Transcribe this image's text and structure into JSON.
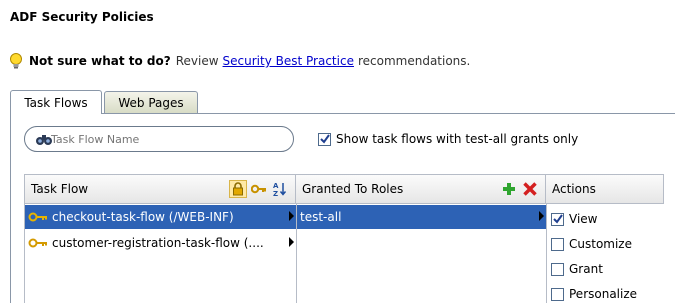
{
  "page": {
    "title": "ADF Security Policies"
  },
  "hint": {
    "bold": "Not sure what to do?",
    "review": "Review",
    "link": "Security Best Practice",
    "suffix": "recommendations."
  },
  "tabs": [
    {
      "label": "Task Flows",
      "active": true
    },
    {
      "label": "Web Pages",
      "active": false
    }
  ],
  "filter": {
    "search_placeholder": "Task Flow Name",
    "show_label": "Show task flows with test-all grants only",
    "show_checked": true
  },
  "columns": {
    "task_flow": "Task Flow",
    "roles": "Granted To Roles",
    "actions": "Actions"
  },
  "task_flows": [
    {
      "label": "checkout-task-flow (/WEB-INF)",
      "selected": true
    },
    {
      "label": "customer-registration-task-flow (....",
      "selected": false
    }
  ],
  "roles": [
    {
      "label": "test-all",
      "selected": true
    }
  ],
  "actions": [
    {
      "label": "View",
      "checked": true
    },
    {
      "label": "Customize",
      "checked": false
    },
    {
      "label": "Grant",
      "checked": false
    },
    {
      "label": "Personalize",
      "checked": false
    }
  ],
  "colors": {
    "selection": "#2d62b5",
    "link": "#0000cc",
    "add": "#2fa52f",
    "remove": "#d42020"
  }
}
